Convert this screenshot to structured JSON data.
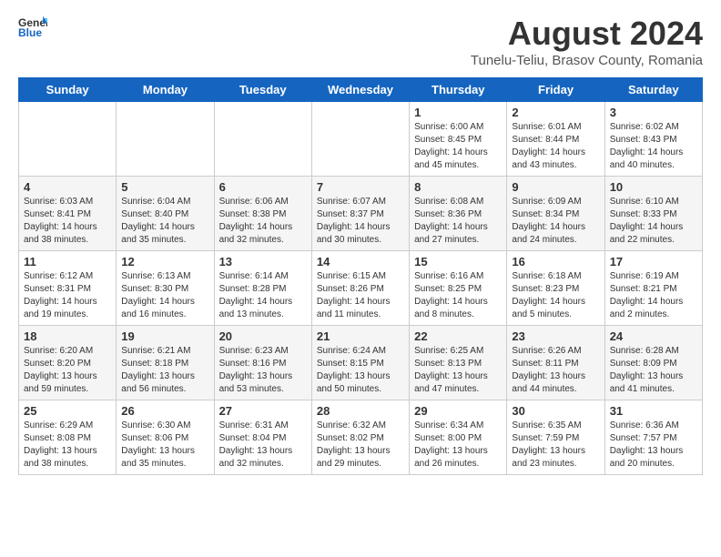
{
  "header": {
    "logo_general": "General",
    "logo_blue": "Blue",
    "month_year": "August 2024",
    "location": "Tunelu-Teliu, Brasov County, Romania"
  },
  "days_of_week": [
    "Sunday",
    "Monday",
    "Tuesday",
    "Wednesday",
    "Thursday",
    "Friday",
    "Saturday"
  ],
  "weeks": [
    [
      {
        "day": "",
        "content": ""
      },
      {
        "day": "",
        "content": ""
      },
      {
        "day": "",
        "content": ""
      },
      {
        "day": "",
        "content": ""
      },
      {
        "day": "1",
        "content": "Sunrise: 6:00 AM\nSunset: 8:45 PM\nDaylight: 14 hours and 45 minutes."
      },
      {
        "day": "2",
        "content": "Sunrise: 6:01 AM\nSunset: 8:44 PM\nDaylight: 14 hours and 43 minutes."
      },
      {
        "day": "3",
        "content": "Sunrise: 6:02 AM\nSunset: 8:43 PM\nDaylight: 14 hours and 40 minutes."
      }
    ],
    [
      {
        "day": "4",
        "content": "Sunrise: 6:03 AM\nSunset: 8:41 PM\nDaylight: 14 hours and 38 minutes."
      },
      {
        "day": "5",
        "content": "Sunrise: 6:04 AM\nSunset: 8:40 PM\nDaylight: 14 hours and 35 minutes."
      },
      {
        "day": "6",
        "content": "Sunrise: 6:06 AM\nSunset: 8:38 PM\nDaylight: 14 hours and 32 minutes."
      },
      {
        "day": "7",
        "content": "Sunrise: 6:07 AM\nSunset: 8:37 PM\nDaylight: 14 hours and 30 minutes."
      },
      {
        "day": "8",
        "content": "Sunrise: 6:08 AM\nSunset: 8:36 PM\nDaylight: 14 hours and 27 minutes."
      },
      {
        "day": "9",
        "content": "Sunrise: 6:09 AM\nSunset: 8:34 PM\nDaylight: 14 hours and 24 minutes."
      },
      {
        "day": "10",
        "content": "Sunrise: 6:10 AM\nSunset: 8:33 PM\nDaylight: 14 hours and 22 minutes."
      }
    ],
    [
      {
        "day": "11",
        "content": "Sunrise: 6:12 AM\nSunset: 8:31 PM\nDaylight: 14 hours and 19 minutes."
      },
      {
        "day": "12",
        "content": "Sunrise: 6:13 AM\nSunset: 8:30 PM\nDaylight: 14 hours and 16 minutes."
      },
      {
        "day": "13",
        "content": "Sunrise: 6:14 AM\nSunset: 8:28 PM\nDaylight: 14 hours and 13 minutes."
      },
      {
        "day": "14",
        "content": "Sunrise: 6:15 AM\nSunset: 8:26 PM\nDaylight: 14 hours and 11 minutes."
      },
      {
        "day": "15",
        "content": "Sunrise: 6:16 AM\nSunset: 8:25 PM\nDaylight: 14 hours and 8 minutes."
      },
      {
        "day": "16",
        "content": "Sunrise: 6:18 AM\nSunset: 8:23 PM\nDaylight: 14 hours and 5 minutes."
      },
      {
        "day": "17",
        "content": "Sunrise: 6:19 AM\nSunset: 8:21 PM\nDaylight: 14 hours and 2 minutes."
      }
    ],
    [
      {
        "day": "18",
        "content": "Sunrise: 6:20 AM\nSunset: 8:20 PM\nDaylight: 13 hours and 59 minutes."
      },
      {
        "day": "19",
        "content": "Sunrise: 6:21 AM\nSunset: 8:18 PM\nDaylight: 13 hours and 56 minutes."
      },
      {
        "day": "20",
        "content": "Sunrise: 6:23 AM\nSunset: 8:16 PM\nDaylight: 13 hours and 53 minutes."
      },
      {
        "day": "21",
        "content": "Sunrise: 6:24 AM\nSunset: 8:15 PM\nDaylight: 13 hours and 50 minutes."
      },
      {
        "day": "22",
        "content": "Sunrise: 6:25 AM\nSunset: 8:13 PM\nDaylight: 13 hours and 47 minutes."
      },
      {
        "day": "23",
        "content": "Sunrise: 6:26 AM\nSunset: 8:11 PM\nDaylight: 13 hours and 44 minutes."
      },
      {
        "day": "24",
        "content": "Sunrise: 6:28 AM\nSunset: 8:09 PM\nDaylight: 13 hours and 41 minutes."
      }
    ],
    [
      {
        "day": "25",
        "content": "Sunrise: 6:29 AM\nSunset: 8:08 PM\nDaylight: 13 hours and 38 minutes."
      },
      {
        "day": "26",
        "content": "Sunrise: 6:30 AM\nSunset: 8:06 PM\nDaylight: 13 hours and 35 minutes."
      },
      {
        "day": "27",
        "content": "Sunrise: 6:31 AM\nSunset: 8:04 PM\nDaylight: 13 hours and 32 minutes."
      },
      {
        "day": "28",
        "content": "Sunrise: 6:32 AM\nSunset: 8:02 PM\nDaylight: 13 hours and 29 minutes."
      },
      {
        "day": "29",
        "content": "Sunrise: 6:34 AM\nSunset: 8:00 PM\nDaylight: 13 hours and 26 minutes."
      },
      {
        "day": "30",
        "content": "Sunrise: 6:35 AM\nSunset: 7:59 PM\nDaylight: 13 hours and 23 minutes."
      },
      {
        "day": "31",
        "content": "Sunrise: 6:36 AM\nSunset: 7:57 PM\nDaylight: 13 hours and 20 minutes."
      }
    ]
  ]
}
